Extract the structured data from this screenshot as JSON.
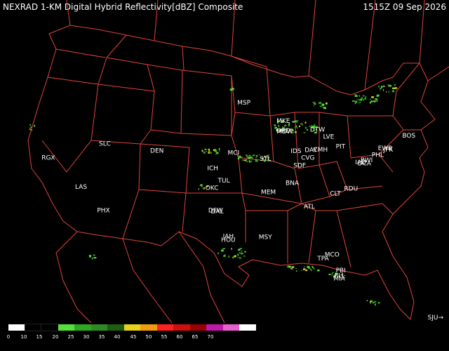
{
  "header": {
    "title": "NEXRAD 1-KM Digital Hybrid Reflectivity[dBZ] Composite",
    "timestamp": "1515Z 09 Sep 2026"
  },
  "legend": {
    "colors": [
      "#ffffff",
      "#000000",
      "#000000",
      "#55e03a",
      "#2fa822",
      "#2d8a24",
      "#1e5e14",
      "#e8d01e",
      "#f09a10",
      "#ff2020",
      "#cc1010",
      "#9a0000",
      "#c018a8",
      "#e860d0",
      "#ffffff"
    ],
    "ticks": [
      "0",
      "10",
      "15",
      "20",
      "25",
      "30",
      "35",
      "40",
      "45",
      "50",
      "55",
      "60",
      "65",
      "70"
    ]
  },
  "nav": {
    "label": "SJU→"
  },
  "map": {
    "cities": [
      {
        "code": "RGX",
        "lon": -119.5,
        "lat": 39.8
      },
      {
        "code": "SLC",
        "lon": -111.9,
        "lat": 40.8
      },
      {
        "code": "DEN",
        "lon": -104.9,
        "lat": 39.7
      },
      {
        "code": "LAS",
        "lon": -115.1,
        "lat": 36.2
      },
      {
        "code": "PHX",
        "lon": -112.1,
        "lat": 33.4
      },
      {
        "code": "MSP",
        "lon": -93.2,
        "lat": 44.9
      },
      {
        "code": "MKE",
        "lon": -87.9,
        "lat": 43.0
      },
      {
        "code": "ORD",
        "lon": -87.9,
        "lat": 41.9
      },
      {
        "code": "MDW",
        "lon": -87.7,
        "lat": 41.8
      },
      {
        "code": "MCI",
        "lon": -94.6,
        "lat": 39.3
      },
      {
        "code": "ICH",
        "lon": -97.4,
        "lat": 37.6
      },
      {
        "code": "STL",
        "lon": -90.3,
        "lat": 38.7
      },
      {
        "code": "IDS",
        "lon": -86.2,
        "lat": 39.7
      },
      {
        "code": "SDF",
        "lon": -85.7,
        "lat": 38.1
      },
      {
        "code": "CVG",
        "lon": -84.6,
        "lat": 39.0
      },
      {
        "code": "DAY",
        "lon": -84.2,
        "lat": 39.9
      },
      {
        "code": "CMH",
        "lon": -82.9,
        "lat": 40.0
      },
      {
        "code": "DTW",
        "lon": -83.3,
        "lat": 42.2
      },
      {
        "code": "LVE",
        "lon": -81.8,
        "lat": 41.5
      },
      {
        "code": "PIT",
        "lon": -80.2,
        "lat": 40.5
      },
      {
        "code": "BOS",
        "lon": -71.0,
        "lat": 42.4
      },
      {
        "code": "JFK",
        "lon": -73.8,
        "lat": 40.6
      },
      {
        "code": "EWR",
        "lon": -74.2,
        "lat": 40.7
      },
      {
        "code": "PHL",
        "lon": -75.2,
        "lat": 39.9
      },
      {
        "code": "BWI",
        "lon": -76.7,
        "lat": 39.2
      },
      {
        "code": "IAD",
        "lon": -77.5,
        "lat": 38.9
      },
      {
        "code": "DCA",
        "lon": -77.0,
        "lat": 38.8
      },
      {
        "code": "TUL",
        "lon": -95.9,
        "lat": 36.2
      },
      {
        "code": "OKC",
        "lon": -97.5,
        "lat": 35.4
      },
      {
        "code": "DFW",
        "lon": -97.0,
        "lat": 32.9
      },
      {
        "code": "DAL",
        "lon": -96.8,
        "lat": 32.8
      },
      {
        "code": "MEM",
        "lon": -89.9,
        "lat": 35.0
      },
      {
        "code": "BNA",
        "lon": -86.7,
        "lat": 36.1
      },
      {
        "code": "ATL",
        "lon": -84.4,
        "lat": 33.6
      },
      {
        "code": "CLT",
        "lon": -80.9,
        "lat": 35.2
      },
      {
        "code": "RDU",
        "lon": -78.8,
        "lat": 35.9
      },
      {
        "code": "IAH",
        "lon": -95.3,
        "lat": 30.0
      },
      {
        "code": "HOU",
        "lon": -95.3,
        "lat": 29.6
      },
      {
        "code": "MSY",
        "lon": -90.3,
        "lat": 30.0
      },
      {
        "code": "MCO",
        "lon": -81.3,
        "lat": 28.4
      },
      {
        "code": "TPA",
        "lon": -82.5,
        "lat": 27.9
      },
      {
        "code": "PBI",
        "lon": -80.1,
        "lat": 26.7
      },
      {
        "code": "FLL",
        "lon": -80.2,
        "lat": 26.1
      },
      {
        "code": "MIA",
        "lon": -80.3,
        "lat": 25.8
      }
    ]
  }
}
